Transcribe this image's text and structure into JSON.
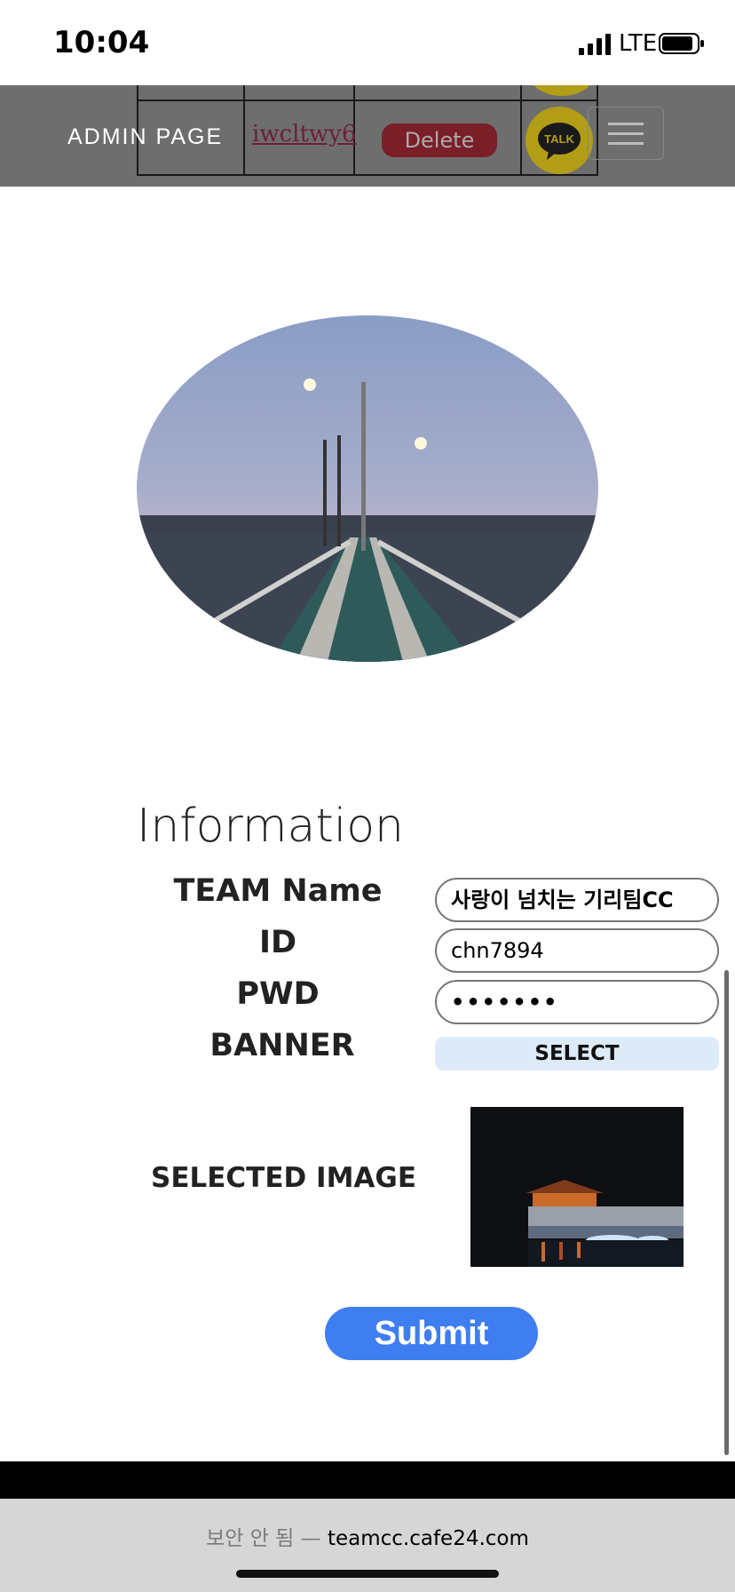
{
  "status_bar": {
    "time": "10:04",
    "network": "LTE"
  },
  "header": {
    "title": "ADMIN PAGE",
    "background_link": "iwcltwy6",
    "background_delete": "Delete",
    "talk_label": "TALK"
  },
  "information": {
    "title": "Information",
    "labels": {
      "team_name": "TEAM Name",
      "id": "ID",
      "pwd": "PWD",
      "banner": "BANNER",
      "selected_image": "SELECTED IMAGE"
    },
    "fields": {
      "team_name": "사랑이 넘치는 기리팀CC",
      "id": "chn7894",
      "pwd": "•••••••"
    },
    "select_label": "SELECT",
    "submit_label": "Submit"
  },
  "url_bar": {
    "warning": "보안 안 됨 —",
    "domain": "teamcc.cafe24.com"
  },
  "colors": {
    "header_bg": "#6e6e6e",
    "submit_bg": "#3f7ef0",
    "select_bg": "#dcebf7",
    "talk_yellow": "#b29d16"
  }
}
